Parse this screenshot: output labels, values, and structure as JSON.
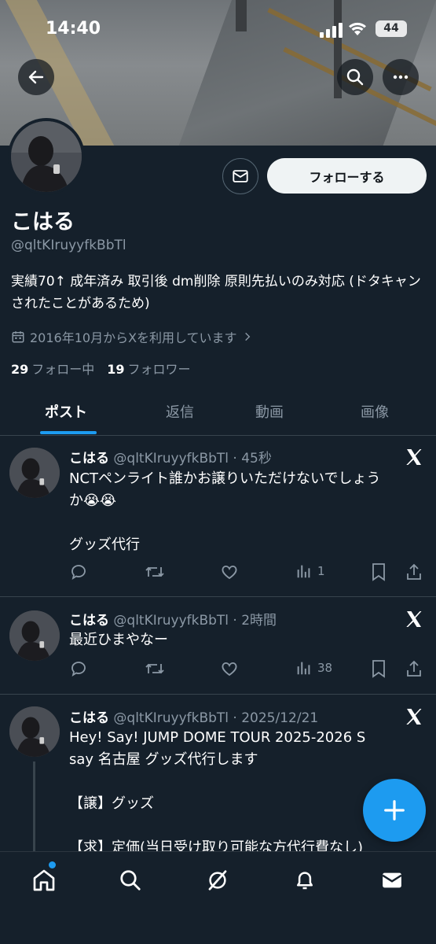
{
  "status_bar": {
    "time": "14:40",
    "battery": "44"
  },
  "profile": {
    "name": "こはる",
    "handle": "@qltKIruyyfkBbTl",
    "bio": "実績70↑ 成年済み 取引後 dm削除 原則先払いのみ対応 (ドタキャンされたことがあるため)",
    "joined": "2016年10月からXを利用しています",
    "following_count": "29",
    "following_label": "フォロー中",
    "followers_count": "19",
    "followers_label": "フォロワー",
    "follow_button": "フォローする"
  },
  "tabs": [
    {
      "label": "ポスト",
      "active": true
    },
    {
      "label": "返信",
      "active": false
    },
    {
      "label": "動画",
      "active": false
    },
    {
      "label": "画像",
      "active": false
    }
  ],
  "posts": [
    {
      "name": "こはる",
      "meta": "@qltKIruyyfkBbTl · 45秒",
      "text_line1": "NCTペンライト誰かお譲りいただけないでしょう",
      "text_line2": "か😭😭",
      "text_line3": "グッズ代行",
      "views": "1"
    },
    {
      "name": "こはる",
      "meta": "@qltKIruyyfkBbTl · 2時間",
      "text_line1": "最近ひまやなー",
      "views": "38"
    },
    {
      "name": "こはる",
      "meta": "@qltKIruyyfkBbTl · 2025/12/21",
      "text_line1": "Hey! Say! JUMP DOME TOUR 2025-2026 S",
      "text_line2": "say 名古屋 グッズ代行します",
      "text_line3": "【譲】グッズ",
      "text_line4": "【求】定価(当日受け取り可能な方代行費なし)"
    }
  ],
  "icons": [
    "back-arrow-icon",
    "search-icon",
    "more-icon",
    "mail-icon",
    "calendar-icon",
    "reply-icon",
    "repost-icon",
    "like-icon",
    "views-icon",
    "bookmark-icon",
    "share-icon",
    "x-logo-icon",
    "plus-icon",
    "home-icon",
    "grok-icon",
    "bell-icon",
    "messages-icon"
  ],
  "colors": {
    "background": "#15202b",
    "accent": "#1d9bf0",
    "muted": "#8b98a5",
    "divider": "#38444d"
  }
}
